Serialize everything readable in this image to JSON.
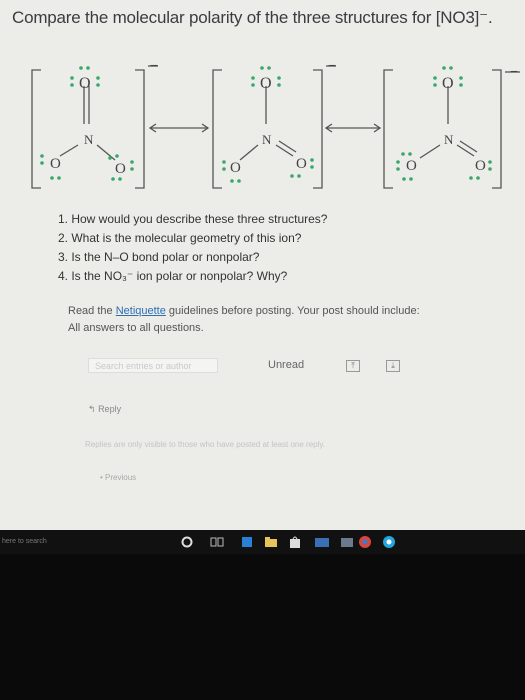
{
  "question": {
    "text": "Compare the molecular polarity of the three structures for [NO3]⁻."
  },
  "structures": {
    "atoms": {
      "O": "O",
      "N": "N"
    },
    "charge": "−"
  },
  "questions": [
    "1. How would you describe these three structures?",
    "2. What is the molecular geometry of this ion?",
    "3. Is the N–O bond polar or nonpolar?",
    "4. Is the NO₃⁻ ion polar or nonpolar? Why?"
  ],
  "instructions": {
    "before": "Read the ",
    "link": "Netiquette",
    "after": " guidelines before posting. Your post should include:",
    "line2": "All answers to all questions."
  },
  "toolbar": {
    "search_placeholder": "Search entries or author",
    "unread": "Unread"
  },
  "reply_label": "Reply",
  "note": "Replies are only visible to those who have posted at least one reply.",
  "previous_label": "• Previous",
  "taskbar": {
    "search": "here to search"
  },
  "colors": {
    "screen_bg": "#ecece9",
    "bond": "#555555",
    "lone_pair": "#3aa86b",
    "link": "#2d6fb3",
    "taskbar": "#111111"
  }
}
